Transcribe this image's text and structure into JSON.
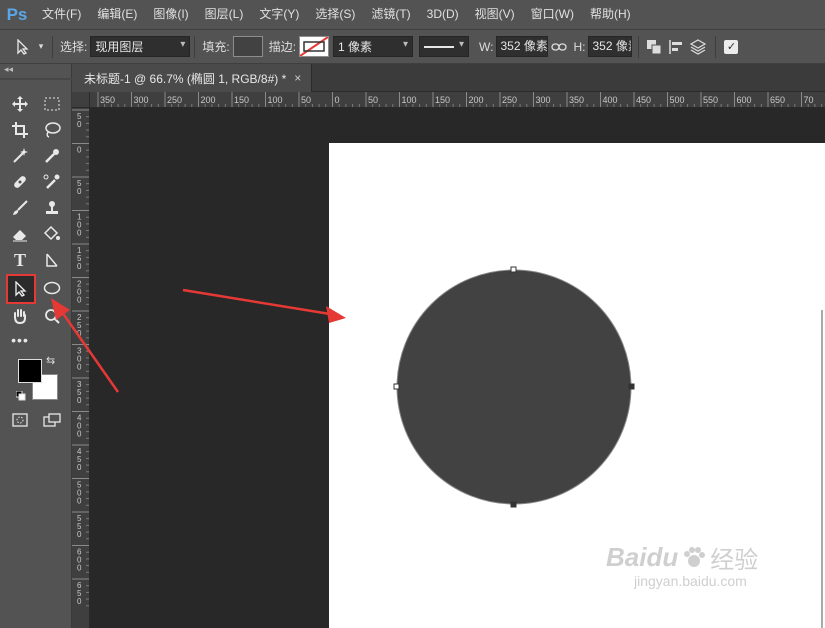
{
  "app": {
    "logo": "Ps",
    "accent": "#5aa7e8"
  },
  "menu": [
    "文件(F)",
    "编辑(E)",
    "图像(I)",
    "图层(L)",
    "文字(Y)",
    "选择(S)",
    "滤镜(T)",
    "3D(D)",
    "视图(V)",
    "窗口(W)",
    "帮助(H)"
  ],
  "options": {
    "select_label": "选择:",
    "select_value": "现用图层",
    "fill_label": "填充:",
    "stroke_label": "描边:",
    "stroke_width": "1 像素",
    "w_label": "W:",
    "w_value": "352 像素",
    "h_label": "H:",
    "h_value": "352 像素"
  },
  "document": {
    "tab_title": "未标题-1 @ 66.7% (椭圆 1, RGB/8#) *",
    "close_glyph": "×"
  },
  "rulers": {
    "horizontal": [
      "350",
      "300",
      "250",
      "200",
      "150",
      "100",
      "50",
      "0",
      "50",
      "100",
      "150",
      "200",
      "250",
      "300",
      "350",
      "400",
      "450",
      "500",
      "550",
      "600",
      "650",
      "70"
    ],
    "vertical": [
      "5 0",
      "0",
      "5 0",
      "1 0 0",
      "1 5 0",
      "2 0 0",
      "2 5 0",
      "3 0 0",
      "3 5 0",
      "4 0 0",
      "4 5 0",
      "5 0 0",
      "5 5 0",
      "6 0 0",
      "6 5 0"
    ]
  },
  "shape": {
    "fill": "#424242",
    "stroke": "#8a8a8a"
  },
  "colors": {
    "foreground": "#000000",
    "background": "#ffffff",
    "highlight": "#e53935"
  },
  "watermark": {
    "brand": "Baidu",
    "brand_cn": "经验",
    "url": "jingyan.baidu.com"
  }
}
